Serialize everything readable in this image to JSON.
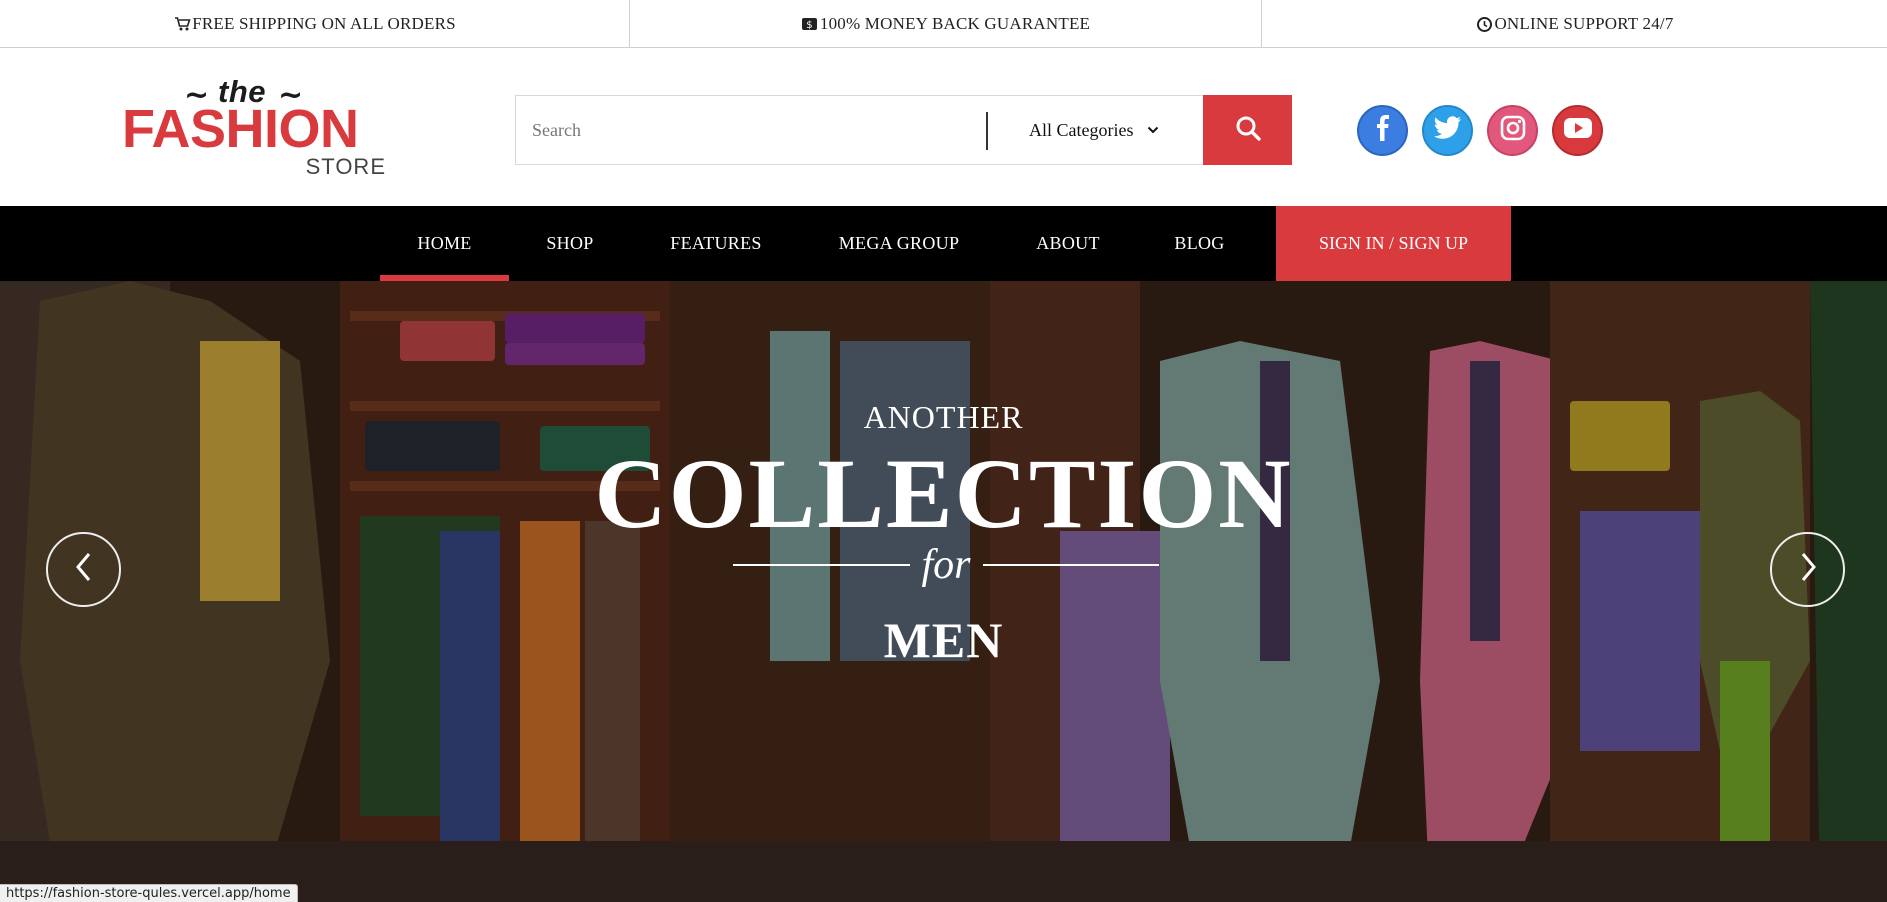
{
  "topbar": {
    "shipping": "FREE SHIPPING ON ALL ORDERS",
    "shipping_icon": "cart-icon",
    "guarantee": "100% MONEY BACK GUARANTEE",
    "guarantee_icon": "money-icon",
    "support": "ONLINE SUPPORT 24/7",
    "support_icon": "clock-icon"
  },
  "logo": {
    "the": "the",
    "fashion": "FASHION",
    "store": "STORE"
  },
  "search": {
    "placeholder": "Search",
    "category": "All Categories",
    "button_icon": "search-icon"
  },
  "socials": [
    "facebook-icon",
    "twitter-icon",
    "instagram-icon",
    "youtube-icon"
  ],
  "nav": {
    "items": [
      "HOME",
      "SHOP",
      "FEATURES",
      "MEGA GROUP",
      "ABOUT",
      "BLOG"
    ],
    "active": "HOME",
    "signin": "SIGN IN / SIGN UP"
  },
  "hero": {
    "line1": "ANOTHER",
    "line2": "COLLECTION",
    "line3": "for",
    "line4": "MEN"
  },
  "status_url": "https://fashion-store-qules.vercel.app/home",
  "colors": {
    "accent": "#d83a3d",
    "nav_bg": "#000000"
  }
}
